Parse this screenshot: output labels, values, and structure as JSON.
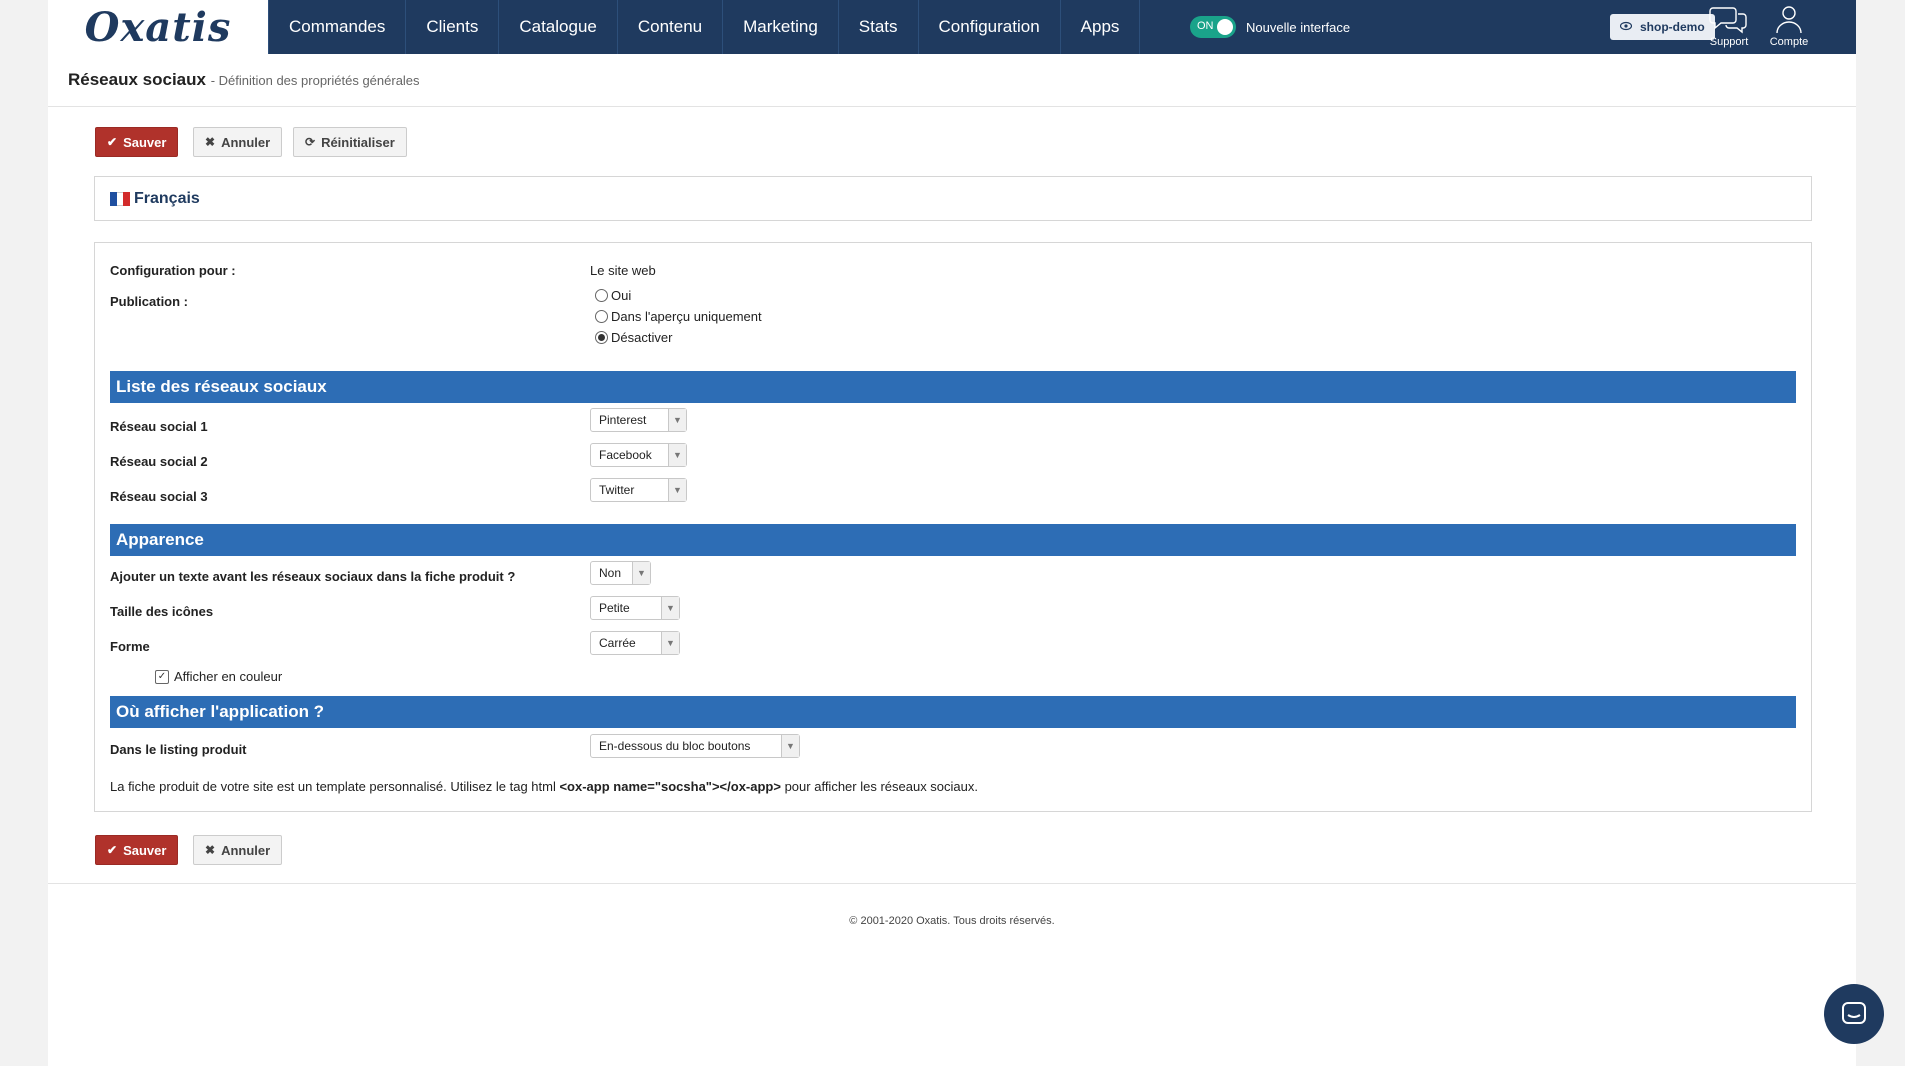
{
  "brand": {
    "logo_text": "Oxatis",
    "nav_color": "#1f3a5f",
    "accent_red": "#b0322b",
    "section_blue": "#2d6db5"
  },
  "nav": {
    "items": [
      {
        "label": "Commandes"
      },
      {
        "label": "Clients"
      },
      {
        "label": "Catalogue"
      },
      {
        "label": "Contenu"
      },
      {
        "label": "Marketing"
      },
      {
        "label": "Stats"
      },
      {
        "label": "Configuration"
      },
      {
        "label": "Apps"
      }
    ],
    "toggle_on_label": "ON",
    "toggle_label": "Nouvelle interface",
    "shop_label": "shop-demo",
    "support_label": "Support",
    "account_label": "Compte"
  },
  "header": {
    "title": "Réseaux sociaux",
    "subtitle": "- Définition des propriétés générales"
  },
  "toolbar": {
    "save_label": "Sauver",
    "cancel_label": "Annuler",
    "reset_label": "Réinitialiser"
  },
  "language": {
    "label": "Français"
  },
  "form": {
    "config_label": "Configuration pour :",
    "config_value": "Le site web",
    "publication_label": "Publication :",
    "publication_options": [
      "Oui",
      "Dans l'aperçu uniquement",
      "Désactiver"
    ],
    "publication_selected": "Désactiver",
    "section_networks": "Liste des réseaux sociaux",
    "network_1_label": "Réseau social 1",
    "network_1_value": "Pinterest",
    "network_2_label": "Réseau social 2",
    "network_2_value": "Facebook",
    "network_3_label": "Réseau social 3",
    "network_3_value": "Twitter",
    "section_appearance": "Apparence",
    "add_text_label": "Ajouter un texte avant les réseaux sociaux dans la fiche produit ?",
    "add_text_value": "Non",
    "icon_size_label": "Taille des icônes",
    "icon_size_value": "Petite",
    "shape_label": "Forme",
    "shape_value": "Carrée",
    "color_checkbox_label": "Afficher en couleur",
    "color_checked": true,
    "section_where": "Où afficher l'application ?",
    "listing_label": "Dans le listing produit",
    "listing_value": "En-dessous du bloc boutons",
    "note_before": "La fiche produit de votre site est un template personnalisé. Utilisez le tag html ",
    "note_tag": "<ox-app name=\"socsha\"></ox-app>",
    "note_after": " pour afficher les réseaux sociaux."
  },
  "footer": {
    "copyright": "© 2001-2020 Oxatis. Tous droits réservés."
  }
}
